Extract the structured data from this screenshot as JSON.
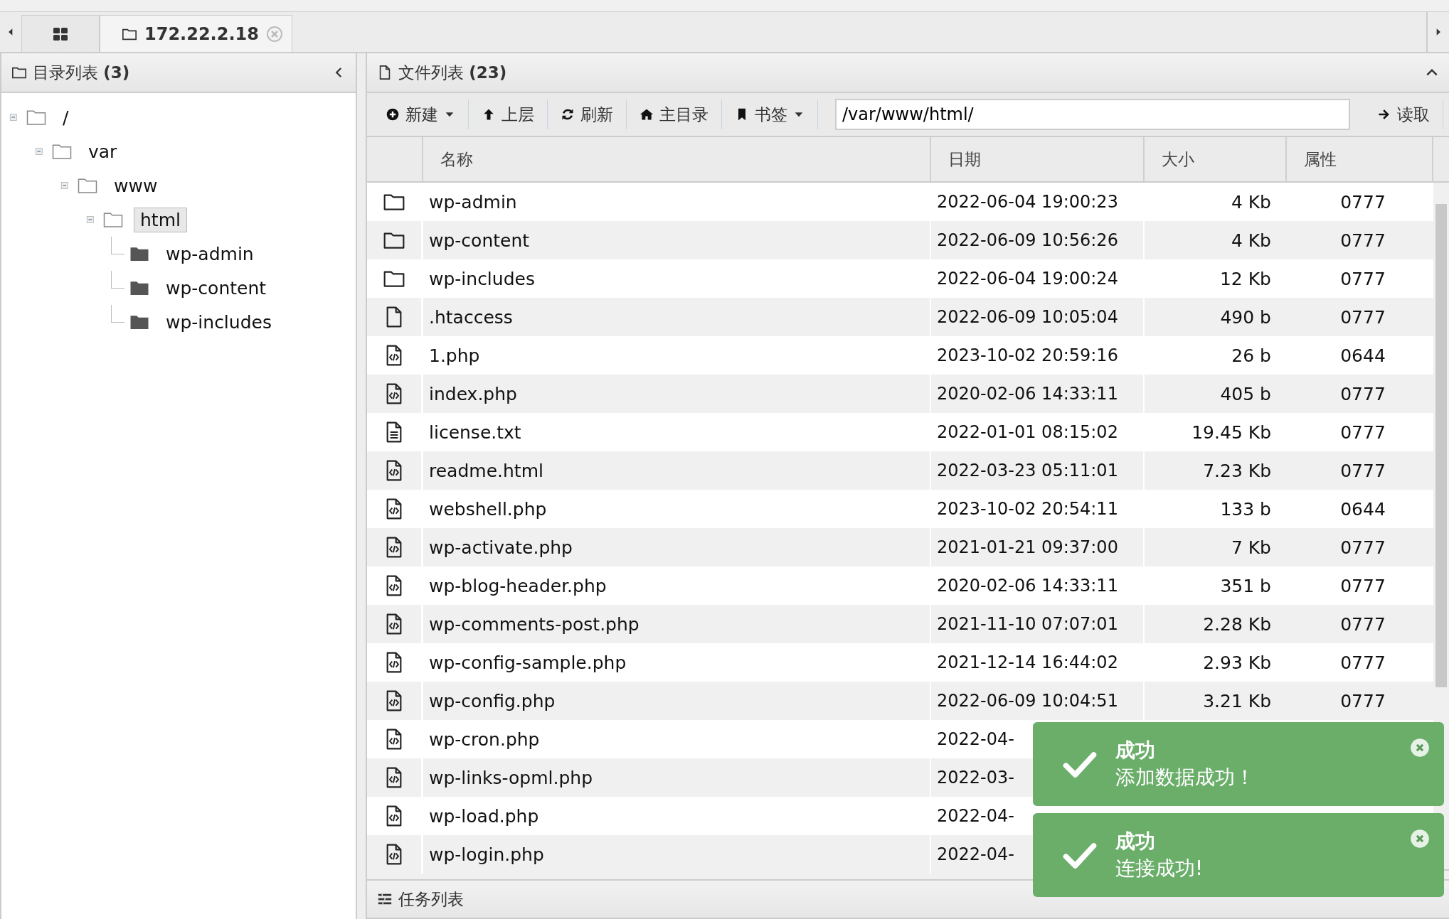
{
  "tabs": [
    {
      "kind": "home",
      "selected": false
    },
    {
      "kind": "folder",
      "label": "172.22.2.18",
      "selected": true
    }
  ],
  "dir_panel": {
    "title": "目录列表",
    "count": "(3)",
    "tree": [
      {
        "label": "/",
        "expanded": true,
        "selected": false,
        "children": [
          {
            "label": "var",
            "expanded": true,
            "selected": false,
            "children": [
              {
                "label": "www",
                "expanded": true,
                "selected": false,
                "children": [
                  {
                    "label": "html",
                    "expanded": true,
                    "selected": true,
                    "children": [
                      {
                        "label": "wp-admin",
                        "selected": false
                      },
                      {
                        "label": "wp-content",
                        "selected": false
                      },
                      {
                        "label": "wp-includes",
                        "selected": false
                      }
                    ]
                  }
                ]
              }
            ]
          }
        ]
      }
    ]
  },
  "file_panel": {
    "title": "文件列表",
    "count": "(23)",
    "toolbar": [
      {
        "kind": "new",
        "label": "新建",
        "dropdown": true
      },
      {
        "kind": "up",
        "label": "上层",
        "dropdown": false
      },
      {
        "kind": "refresh",
        "label": "刷新",
        "dropdown": false
      },
      {
        "kind": "home",
        "label": "主目录",
        "dropdown": false
      },
      {
        "kind": "bookmark",
        "label": "书签",
        "dropdown": true
      }
    ],
    "path": "/var/www/html/",
    "read_button": "读取",
    "columns": [
      "名称",
      "日期",
      "大小",
      "属性"
    ],
    "rows": [
      {
        "kind": "folder",
        "name": "wp-admin",
        "date": "2022-06-04 19:00:23",
        "size": "4 Kb",
        "perm": "0777"
      },
      {
        "kind": "folder",
        "name": "wp-content",
        "date": "2022-06-09 10:56:26",
        "size": "4 Kb",
        "perm": "0777"
      },
      {
        "kind": "folder",
        "name": "wp-includes",
        "date": "2022-06-04 19:00:24",
        "size": "12 Kb",
        "perm": "0777"
      },
      {
        "kind": "file",
        "name": ".htaccess",
        "date": "2022-06-09 10:05:04",
        "size": "490 b",
        "perm": "0777"
      },
      {
        "kind": "code",
        "name": "1.php",
        "date": "2023-10-02 20:59:16",
        "size": "26 b",
        "perm": "0644"
      },
      {
        "kind": "code",
        "name": "index.php",
        "date": "2020-02-06 14:33:11",
        "size": "405 b",
        "perm": "0777"
      },
      {
        "kind": "text",
        "name": "license.txt",
        "date": "2022-01-01 08:15:02",
        "size": "19.45 Kb",
        "perm": "0777"
      },
      {
        "kind": "code",
        "name": "readme.html",
        "date": "2022-03-23 05:11:01",
        "size": "7.23 Kb",
        "perm": "0777"
      },
      {
        "kind": "code",
        "name": "webshell.php",
        "date": "2023-10-02 20:54:11",
        "size": "133 b",
        "perm": "0644"
      },
      {
        "kind": "code",
        "name": "wp-activate.php",
        "date": "2021-01-21 09:37:00",
        "size": "7 Kb",
        "perm": "0777"
      },
      {
        "kind": "code",
        "name": "wp-blog-header.php",
        "date": "2020-02-06 14:33:11",
        "size": "351 b",
        "perm": "0777"
      },
      {
        "kind": "code",
        "name": "wp-comments-post.php",
        "date": "2021-11-10 07:07:01",
        "size": "2.28 Kb",
        "perm": "0777"
      },
      {
        "kind": "code",
        "name": "wp-config-sample.php",
        "date": "2021-12-14 16:44:02",
        "size": "2.93 Kb",
        "perm": "0777"
      },
      {
        "kind": "code",
        "name": "wp-config.php",
        "date": "2022-06-09 10:04:51",
        "size": "3.21 Kb",
        "perm": "0777"
      },
      {
        "kind": "code",
        "name": "wp-cron.php",
        "date": "2022-04-"
      },
      {
        "kind": "code",
        "name": "wp-links-opml.php",
        "date": "2022-03-"
      },
      {
        "kind": "code",
        "name": "wp-load.php",
        "date": "2022-04-"
      },
      {
        "kind": "code",
        "name": "wp-login.php",
        "date": "2022-04-"
      }
    ]
  },
  "task_panel": {
    "title": "任务列表"
  },
  "toasts": [
    {
      "title": "成功",
      "message": "添加数据成功！"
    },
    {
      "title": "成功",
      "message": "连接成功!"
    }
  ]
}
